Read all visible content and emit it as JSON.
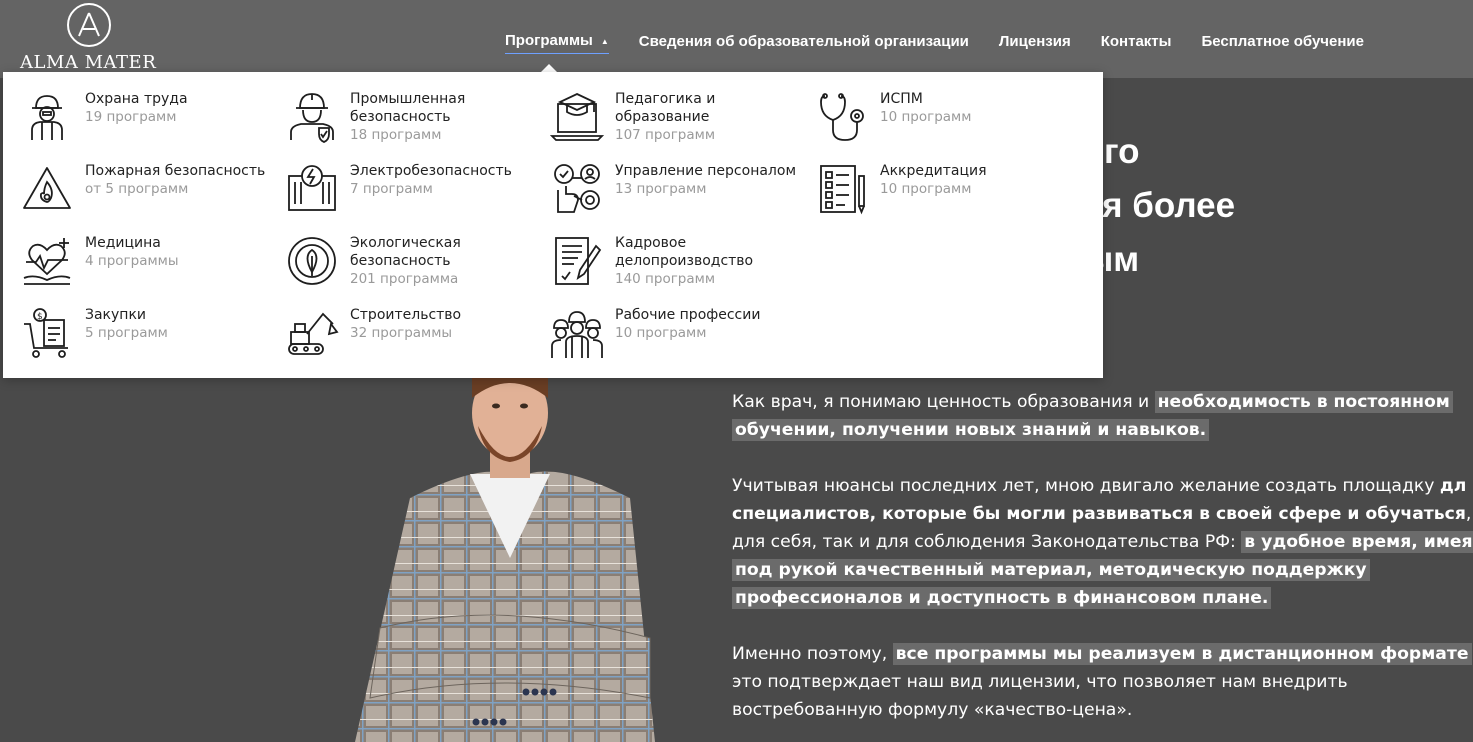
{
  "brand": {
    "name": "ALMA MATER"
  },
  "nav": [
    {
      "label": "Программы",
      "active": true
    },
    {
      "label": "Сведения об образовательной организации"
    },
    {
      "label": "Лицензия"
    },
    {
      "label": "Контакты"
    },
    {
      "label": "Бесплатное обучение"
    }
  ],
  "dropdown": {
    "items": [
      {
        "title": "Охрана труда",
        "count": "19 программ",
        "icon": "worker-safety-icon"
      },
      {
        "title": "Промышленная безопасность",
        "count": "18 программ",
        "icon": "industrial-worker-icon"
      },
      {
        "title": "Педагогика и образование",
        "count": "107 программ",
        "icon": "graduation-laptop-icon"
      },
      {
        "title": "ИСПМ",
        "count": "10 программ",
        "icon": "stethoscope-icon"
      },
      {
        "title": "Пожарная безопасность",
        "count": "от 5 программ",
        "icon": "fire-warning-icon"
      },
      {
        "title": "Электробезопасность",
        "count": "7 программ",
        "icon": "electric-panel-icon"
      },
      {
        "title": "Управление персоналом",
        "count": "13 программ",
        "icon": "hr-management-icon"
      },
      {
        "title": "Аккредитация",
        "count": "10 программ",
        "icon": "checklist-icon"
      },
      {
        "title": "Медицина",
        "count": "4 программы",
        "icon": "heart-medicine-icon"
      },
      {
        "title": "Экологическая безопасность",
        "count": "201 программа",
        "icon": "eco-leaf-icon"
      },
      {
        "title": "Кадровое делопроизводство",
        "count": "140 программ",
        "icon": "document-pen-icon"
      },
      {
        "title": "Закупки",
        "count": "5 программ",
        "icon": "shopping-cart-icon"
      },
      {
        "title": "Строительство",
        "count": "32 программы",
        "icon": "excavator-icon"
      },
      {
        "title": "Рабочие профессии",
        "count": "10 программ",
        "icon": "workers-group-icon"
      }
    ]
  },
  "hero": {
    "heading_lines": [
      "ьного",
      "ания более",
      "лным"
    ]
  },
  "text": {
    "p1_a": "Как врач, я понимаю ценность образования и ",
    "p1_b": "необходимость в постоянном",
    "p1_c": "обучении, получении новых знаний и навыков.",
    "p2_a": "Учитывая нюансы последних лет, мною двигало желание создать площадку ",
    "p2_b": "дл",
    "p2_c": "специалистов, которые бы могли развиваться в своей сфере и обучаться",
    "p2_d": ", к",
    "p2_e": "для себя, так и для соблюдения Законодательства РФ: ",
    "p2_f": "в удобное время, имея",
    "p2_g": "под рукой качественный материал, методическую поддержку",
    "p2_h": "профессионалов и доступность в финансовом плане.",
    "p3_a": "Именно поэтому, ",
    "p3_b": "все программы мы реализуем в дистанционном формате",
    "p3_c": " -",
    "p3_d": "это подтверждает наш вид лицензии, что позволяет нам внедрить",
    "p3_e": "востребованную формулу «качество-цена»."
  }
}
